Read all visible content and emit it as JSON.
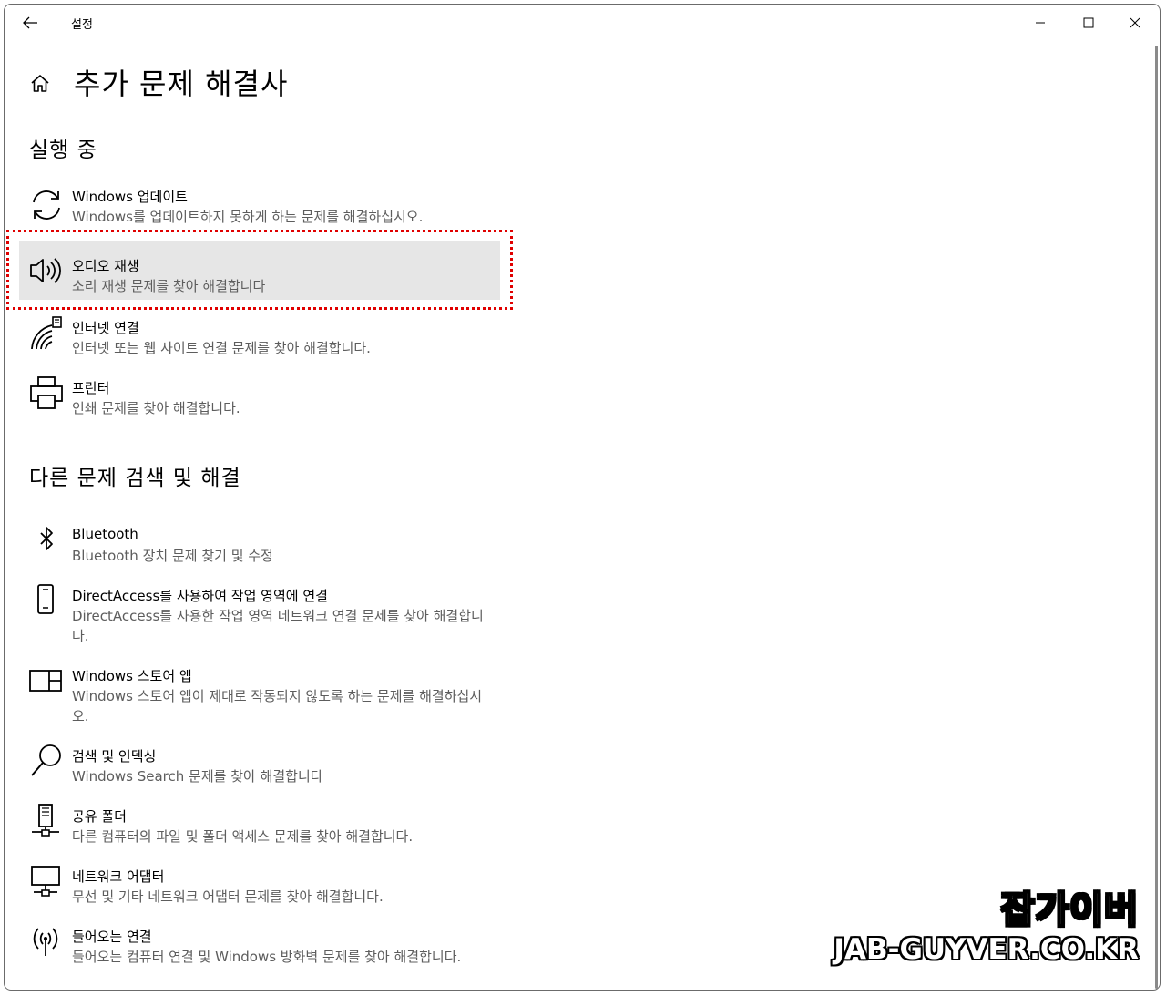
{
  "window": {
    "title": "설정",
    "controls": {
      "minimize": "minimize",
      "maximize": "maximize",
      "close": "close"
    }
  },
  "page": {
    "title": "추가 문제 해결사"
  },
  "sections": {
    "running": {
      "title": "실행 중",
      "items": [
        {
          "title": "Windows 업데이트",
          "desc": "Windows를 업데이트하지 못하게 하는 문제를 해결하십시오.",
          "icon": "sync-icon"
        },
        {
          "title": "오디오 재생",
          "desc": "소리 재생 문제를 찾아 해결합니다",
          "icon": "speaker-icon",
          "selected": true
        },
        {
          "title": "인터넷 연결",
          "desc": "인터넷 또는 웹 사이트 연결 문제를 찾아 해결합니다.",
          "icon": "wifi-icon"
        },
        {
          "title": "프린터",
          "desc": "인쇄 문제를 찾아 해결합니다.",
          "icon": "printer-icon"
        }
      ]
    },
    "other": {
      "title": "다른 문제 검색 및 해결",
      "items": [
        {
          "title": "Bluetooth",
          "desc": "Bluetooth 장치 문제 찾기 및 수정",
          "icon": "bluetooth-icon"
        },
        {
          "title": "DirectAccess를 사용하여 작업 영역에 연결",
          "desc": "DirectAccess를 사용한 작업 영역 네트워크 연결 문제를 찾아 해결합니다.",
          "icon": "phone-icon"
        },
        {
          "title": "Windows 스토어 앱",
          "desc": "Windows 스토어 앱이 제대로 작동되지 않도록 하는 문제를 해결하십시오.",
          "icon": "window-icon"
        },
        {
          "title": "검색 및 인덱싱",
          "desc": "Windows Search 문제를 찾아 해결합니다",
          "icon": "search-icon"
        },
        {
          "title": "공유 폴더",
          "desc": "다른 컴퓨터의 파일 및 폴더 액세스 문제를 찾아 해결합니다.",
          "icon": "shared-folder-icon"
        },
        {
          "title": "네트워크 어댑터",
          "desc": "무선 및 기타 네트워크 어댑터 문제를 찾아 해결합니다.",
          "icon": "network-adapter-icon"
        },
        {
          "title": "들어오는 연결",
          "desc": "들어오는 컴퓨터 연결 및 Windows 방화벽 문제를 찾아 해결합니다.",
          "icon": "antenna-icon"
        }
      ]
    }
  },
  "watermark": {
    "korean": "잡가이버",
    "url": "JAB-GUYVER.CO.KR"
  },
  "colors": {
    "selected_bg": "#e6e6e6",
    "highlight_border": "#e00000",
    "desc_text": "#5d5d5d"
  }
}
